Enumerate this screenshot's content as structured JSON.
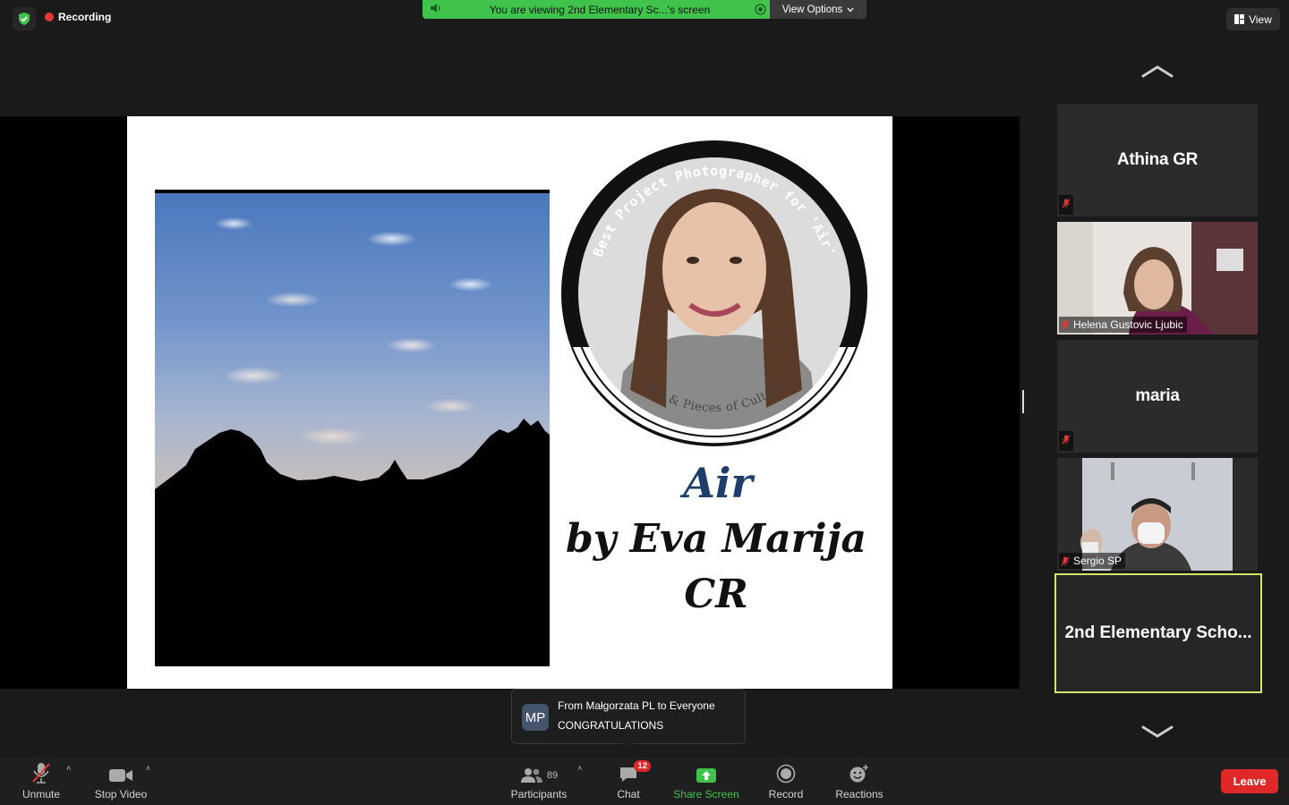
{
  "top": {
    "recording_label": "Recording",
    "viewing_text": "You are viewing 2nd Elementary Sc...'s screen",
    "view_options_label": "View Options",
    "view_button_label": "View",
    "colors": {
      "security_green": "#3fc34a",
      "recording_red": "#e53935"
    }
  },
  "slide": {
    "badge_top_text": "Best Project Photographer for 'Air'",
    "badge_bottom_text": "Bits & Pieces of Culture",
    "title": "Air",
    "byline_1": "by Eva Marija",
    "byline_2": "CR"
  },
  "gallery": {
    "participants": [
      {
        "name": "Athina GR",
        "muted": true,
        "video": false
      },
      {
        "name": "Helena Gustovic Ljubic",
        "muted": true,
        "video": true
      },
      {
        "name": "maria",
        "muted": true,
        "video": false
      },
      {
        "name": "Sergio SP",
        "muted": true,
        "video": true
      }
    ],
    "active_speaker": "2nd Elementary Scho...",
    "active_border_color": "#d6e46a"
  },
  "chat_toast": {
    "avatar_initials": "MP",
    "from": "From Małgorzata PL to Everyone",
    "message": "CONGRATULATIONS"
  },
  "toolbar": {
    "unmute_label": "Unmute",
    "stop_video_label": "Stop Video",
    "participants_label": "Participants",
    "participants_count": "89",
    "chat_label": "Chat",
    "chat_unread": "12",
    "share_screen_label": "Share Screen",
    "record_label": "Record",
    "reactions_label": "Reactions",
    "leave_label": "Leave",
    "share_color": "#3fc34a",
    "leave_color": "#e02828"
  }
}
